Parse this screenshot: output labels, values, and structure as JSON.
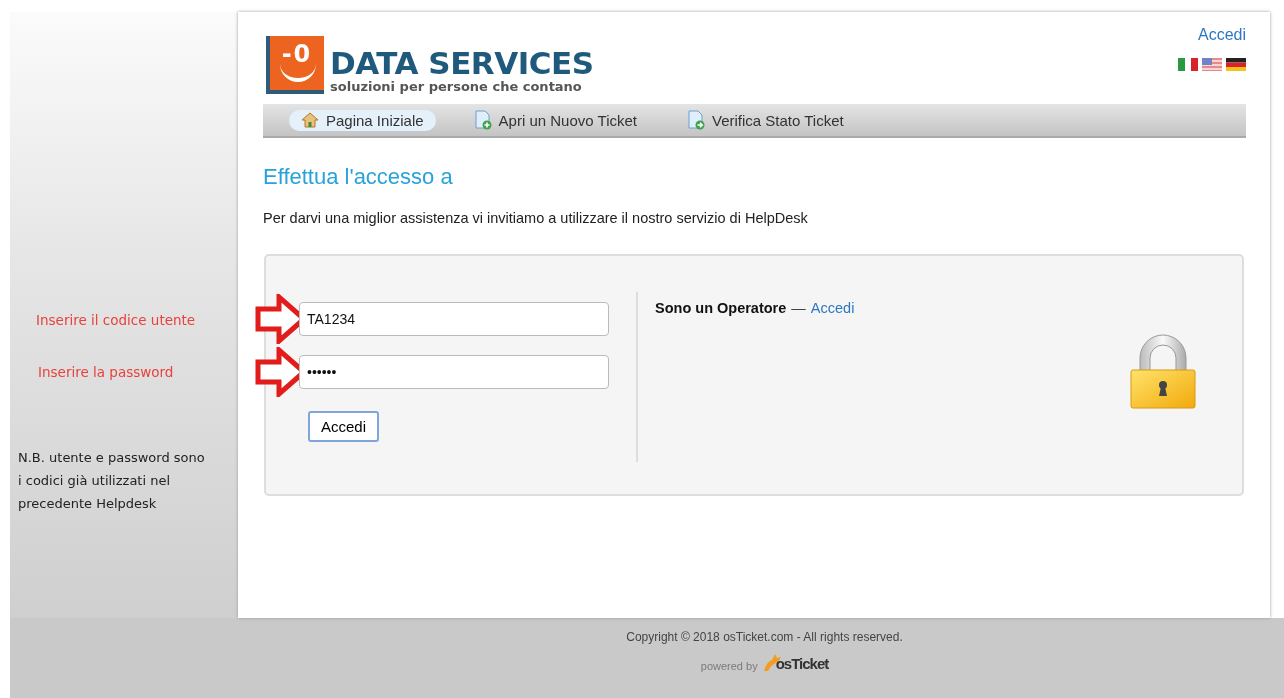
{
  "annotations": [
    {
      "kind": "hint",
      "text": "Inserire il codice utente"
    },
    {
      "kind": "hint",
      "text": "Inserire la password"
    },
    {
      "kind": "note",
      "text": "N.B. utente e password sono i codici già utilizzati nel precedente Helpdesk"
    }
  ],
  "header": {
    "logo_mark": "-0",
    "logo_name": "DATA SERVICES",
    "tagline": "soluzioni per persone che contano",
    "login_link": "Accedi",
    "flags": [
      {
        "kind": "it"
      },
      {
        "kind": "us"
      },
      {
        "kind": "de"
      }
    ]
  },
  "nav": [
    {
      "label": "Pagina Iniziale",
      "kind": "home",
      "selected": true
    },
    {
      "label": "Apri un Nuovo Ticket",
      "kind": "new",
      "selected": false
    },
    {
      "label": "Verifica Stato Ticket",
      "kind": "check",
      "selected": false
    }
  ],
  "title": "Effettua l'accesso a",
  "intro": "Per darvi una miglior assistenza vi invitiamo a utilizzare il nostro servizio di HelpDesk",
  "login_form": {
    "username": "TA1234",
    "password": "••••••",
    "submit": "Accedi"
  },
  "operator": {
    "label": "Sono un Operatore",
    "separator": "—",
    "link": "Accedi"
  },
  "footer": {
    "copyright": "Copyright © 2018 osTicket.com - All rights reserved.",
    "powered_by": "powered by",
    "brand": "osTicket"
  }
}
